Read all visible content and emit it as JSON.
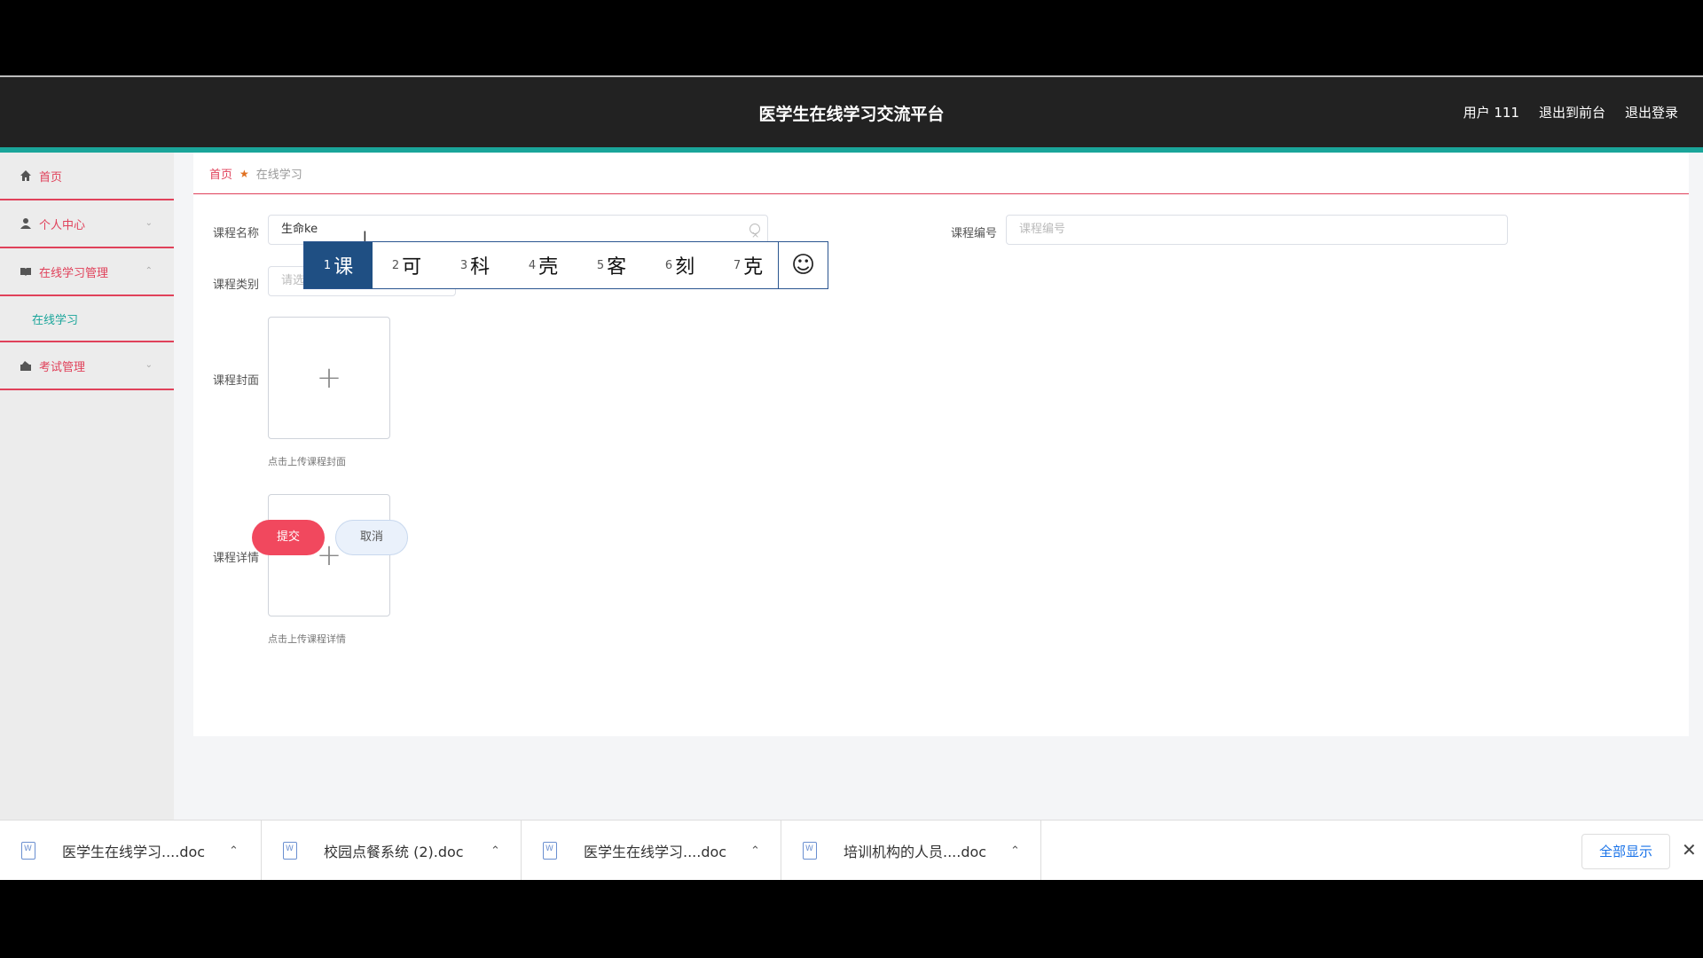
{
  "header": {
    "title": "医学生在线学习交流平台",
    "user": "用户 111",
    "back_to_front": "退出到前台",
    "logout": "退出登录"
  },
  "sidebar": {
    "items": [
      {
        "label": "首页",
        "icon": "home-icon"
      },
      {
        "label": "个人中心",
        "icon": "user-icon"
      },
      {
        "label": "在线学习管理",
        "icon": "book-icon"
      },
      {
        "label": "在线学习"
      },
      {
        "label": "考试管理",
        "icon": "exam-icon"
      }
    ]
  },
  "breadcrumb": {
    "home": "首页",
    "current": "在线学习"
  },
  "form": {
    "course_name_label": "课程名称",
    "course_name_value": "生命ke",
    "course_no_label": "课程编号",
    "course_no_placeholder": "课程编号",
    "course_type_label": "课程类别",
    "course_type_placeholder": "请选",
    "cover_label": "课程封面",
    "cover_hint": "点击上传课程封面",
    "detail_label": "课程详情",
    "detail_hint": "点击上传课程详情",
    "submit": "提交",
    "cancel": "取消"
  },
  "ime": {
    "candidates": [
      {
        "n": "1",
        "c": "课"
      },
      {
        "n": "2",
        "c": "可"
      },
      {
        "n": "3",
        "c": "科"
      },
      {
        "n": "4",
        "c": "壳"
      },
      {
        "n": "5",
        "c": "客"
      },
      {
        "n": "6",
        "c": "刻"
      },
      {
        "n": "7",
        "c": "克"
      }
    ],
    "emoji": "☺"
  },
  "downloads": {
    "items": [
      "医学生在线学习....doc",
      "校园点餐系统 (2).doc",
      "医学生在线学习....doc",
      "培训机构的人员....doc"
    ],
    "show_all": "全部显示"
  },
  "colors": {
    "accent": "#e0415a",
    "teal": "#1aa59a",
    "ime_selected": "#1f4f83"
  }
}
